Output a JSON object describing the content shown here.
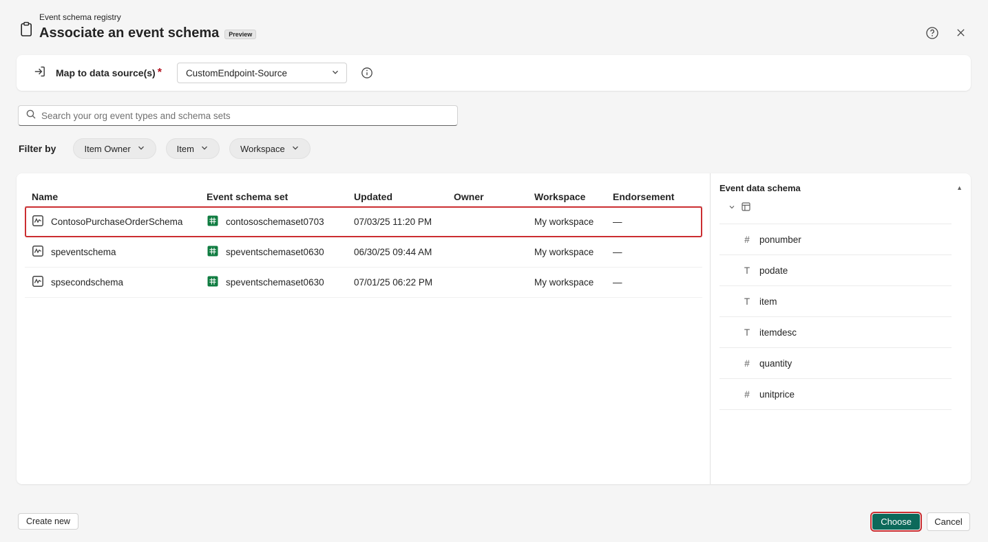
{
  "header": {
    "registry_label": "Event schema registry",
    "title": "Associate an event schema",
    "preview_badge": "Preview"
  },
  "datasource": {
    "label": "Map to data source(s)",
    "required_mark": "*",
    "selected": "CustomEndpoint-Source"
  },
  "search": {
    "placeholder": "Search your org event types and schema sets"
  },
  "filters": {
    "label": "Filter by",
    "pills": [
      {
        "label": "Item Owner"
      },
      {
        "label": "Item"
      },
      {
        "label": "Workspace"
      }
    ]
  },
  "table": {
    "columns": [
      "Name",
      "Event schema set",
      "Updated",
      "Owner",
      "Workspace",
      "Endorsement"
    ],
    "rows": [
      {
        "name": "ContosoPurchaseOrderSchema",
        "schema_set": "contososchemaset0703",
        "updated": "07/03/25 11:20 PM",
        "owner": "",
        "workspace": "My workspace",
        "endorsement": "—",
        "selected": true
      },
      {
        "name": "speventschema",
        "schema_set": "speventschemaset0630",
        "updated": "06/30/25 09:44 AM",
        "owner": "",
        "workspace": "My workspace",
        "endorsement": "—",
        "selected": false
      },
      {
        "name": "spsecondschema",
        "schema_set": "speventschemaset0630",
        "updated": "07/01/25 06:22 PM",
        "owner": "",
        "workspace": "My workspace",
        "endorsement": "—",
        "selected": false
      }
    ]
  },
  "schema_panel": {
    "title": "Event data schema",
    "fields": [
      {
        "type": "number",
        "label": "ponumber"
      },
      {
        "type": "text",
        "label": "podate"
      },
      {
        "type": "text",
        "label": "item"
      },
      {
        "type": "text",
        "label": "itemdesc"
      },
      {
        "type": "number",
        "label": "quantity"
      },
      {
        "type": "number",
        "label": "unitprice"
      }
    ]
  },
  "footer": {
    "create_new": "Create new",
    "choose": "Choose",
    "cancel": "Cancel"
  },
  "icons": {
    "scroll_up": "▲",
    "field_type_glyphs": {
      "number": "#",
      "text": "T"
    }
  },
  "colors": {
    "accent_green": "#0c695a",
    "highlight_red": "#cb2d30",
    "schema_set_icon_green": "#107c41"
  }
}
